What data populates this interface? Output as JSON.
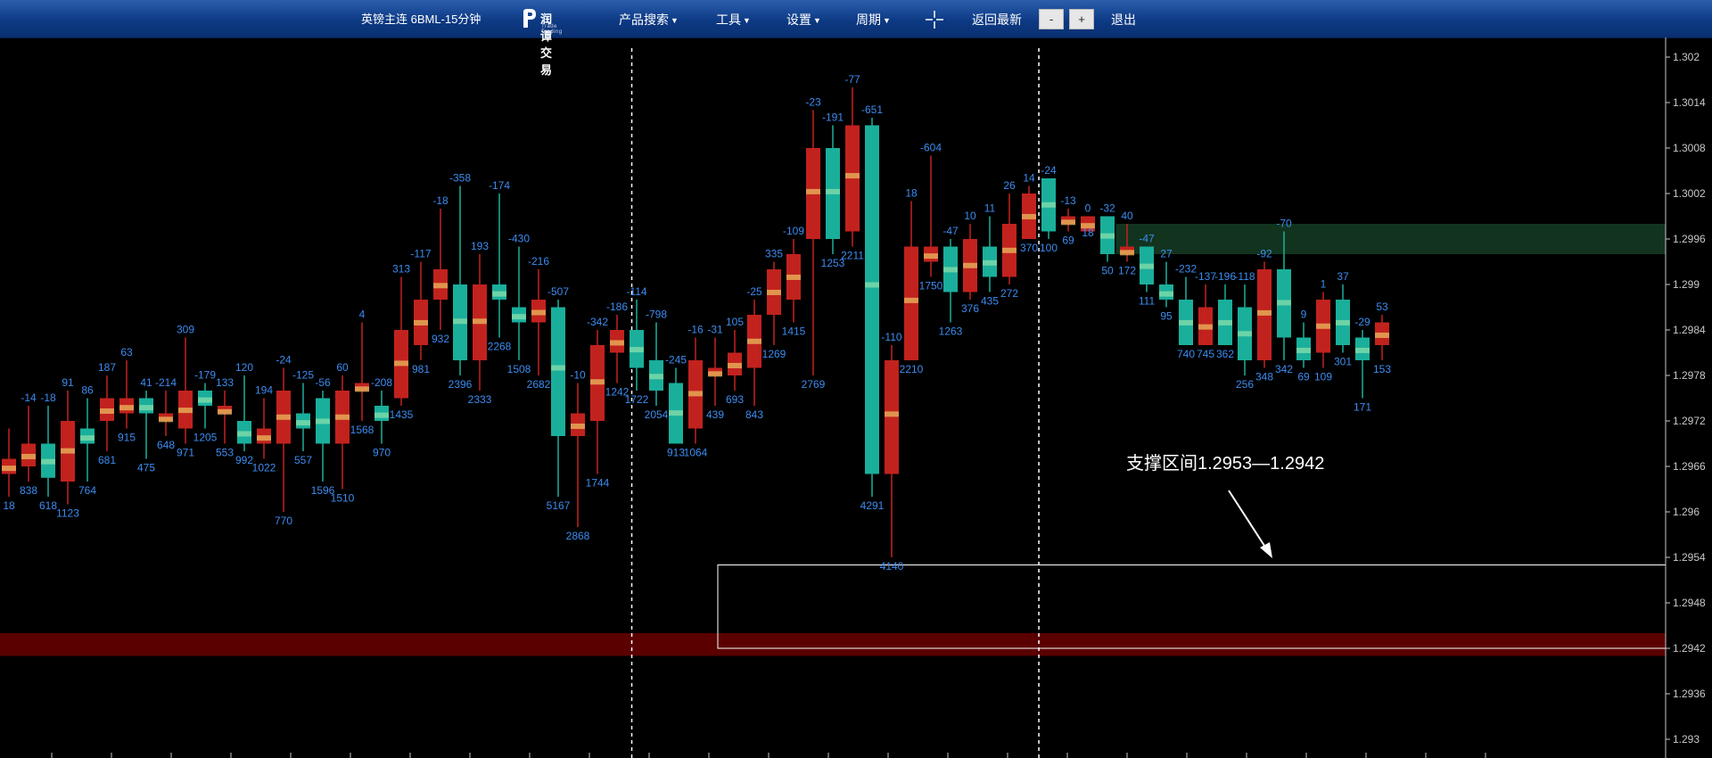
{
  "toolbar": {
    "symbol": "英镑主连 6BML-15分钟",
    "logo_name": "润谭交易",
    "logo_sub": "Trade Trading",
    "menu_product": "产品搜索",
    "menu_tools": "工具",
    "menu_settings": "设置",
    "menu_period": "周期",
    "back_latest": "返回最新",
    "zoom_out": "-",
    "zoom_in": "+",
    "exit": "退出"
  },
  "annotation": {
    "text": "支撑区间1.2953—1.2942"
  },
  "colors": {
    "bull": "#1aaf9b",
    "bear": "#c2221e",
    "bull_light": "#7fdcaa",
    "bear_light": "#e8b15a",
    "label": "#3c8cf0",
    "axis": "#c8c8c8",
    "support_zone": "#5a0000",
    "resistance_zone": "#143a22",
    "annotation_box": "#ffffff"
  },
  "chart_data": {
    "type": "candlestick",
    "price_axis": {
      "ticks": [
        "1.302",
        "1.3014",
        "1.3008",
        "1.3002",
        "1.2996",
        "1.299",
        "1.2984",
        "1.2978",
        "1.2972",
        "1.2966",
        "1.296",
        "1.2954",
        "1.2948",
        "1.2942",
        "1.2936",
        "1.293"
      ]
    },
    "session_separators": [
      0.3793,
      0.6237
    ],
    "zones": [
      {
        "kind": "support",
        "from": 1.2944,
        "to": 1.2941,
        "x0": 0.0,
        "x1": 1.0,
        "color": "#5a0000"
      },
      {
        "kind": "resistance",
        "from": 1.2998,
        "to": 1.2994,
        "x0": 0.67,
        "x1": 1.0,
        "color": "#143a22"
      },
      {
        "kind": "support-box",
        "from": 1.2953,
        "to": 1.2942,
        "x0": 0.42,
        "x1": 1.0
      }
    ],
    "candles": [
      {
        "o": 1.2967,
        "h": 1.2971,
        "l": 1.2962,
        "c": 1.2965,
        "top": "",
        "bot": "18"
      },
      {
        "o": 1.2969,
        "h": 1.2974,
        "l": 1.2964,
        "c": 1.2966,
        "top": "-14",
        "bot": "838"
      },
      {
        "o": 1.29645,
        "h": 1.2974,
        "l": 1.2962,
        "c": 1.2969,
        "top": "-18",
        "bot": "618"
      },
      {
        "o": 1.2972,
        "h": 1.2976,
        "l": 1.2961,
        "c": 1.2964,
        "top": "91",
        "bot": "1123"
      },
      {
        "o": 1.2969,
        "h": 1.2975,
        "l": 1.2964,
        "c": 1.2971,
        "top": "86",
        "bot": "764"
      },
      {
        "o": 1.2975,
        "h": 1.2978,
        "l": 1.2968,
        "c": 1.2972,
        "top": "187",
        "bot": "681"
      },
      {
        "o": 1.2975,
        "h": 1.298,
        "l": 1.2971,
        "c": 1.2973,
        "top": "63",
        "bot": "915"
      },
      {
        "o": 1.2973,
        "h": 1.2976,
        "l": 1.2967,
        "c": 1.2975,
        "top": "41",
        "bot": "475"
      },
      {
        "o": 1.2973,
        "h": 1.2976,
        "l": 1.297,
        "c": 1.2972,
        "top": "-214",
        "bot": "648"
      },
      {
        "o": 1.2976,
        "h": 1.2983,
        "l": 1.2969,
        "c": 1.2971,
        "top": "309",
        "bot": "971"
      },
      {
        "o": 1.2974,
        "h": 1.2977,
        "l": 1.2971,
        "c": 1.2976,
        "top": "-179",
        "bot": "1205"
      },
      {
        "o": 1.2974,
        "h": 1.2976,
        "l": 1.2969,
        "c": 1.2973,
        "top": "133",
        "bot": "553"
      },
      {
        "o": 1.2969,
        "h": 1.2978,
        "l": 1.2968,
        "c": 1.2972,
        "top": "120",
        "bot": "992"
      },
      {
        "o": 1.2971,
        "h": 1.2975,
        "l": 1.2967,
        "c": 1.2969,
        "top": "194",
        "bot": "1022"
      },
      {
        "o": 1.2976,
        "h": 1.2979,
        "l": 1.296,
        "c": 1.2969,
        "top": "-24",
        "bot": "770"
      },
      {
        "o": 1.2971,
        "h": 1.2977,
        "l": 1.2968,
        "c": 1.2973,
        "top": "-125",
        "bot": "557"
      },
      {
        "o": 1.2969,
        "h": 1.2976,
        "l": 1.2964,
        "c": 1.2975,
        "top": "-56",
        "bot": "1596"
      },
      {
        "o": 1.2976,
        "h": 1.2978,
        "l": 1.2963,
        "c": 1.2969,
        "top": "60",
        "bot": "1510"
      },
      {
        "o": 1.2977,
        "h": 1.2985,
        "l": 1.2972,
        "c": 1.2976,
        "top": "4",
        "bot": "1568"
      },
      {
        "o": 1.2972,
        "h": 1.2976,
        "l": 1.2969,
        "c": 1.2974,
        "top": "-208",
        "bot": "970"
      },
      {
        "o": 1.2984,
        "h": 1.2991,
        "l": 1.2974,
        "c": 1.2975,
        "top": "313",
        "bot": "1435"
      },
      {
        "o": 1.2988,
        "h": 1.2993,
        "l": 1.298,
        "c": 1.2982,
        "top": "-117",
        "bot": "981"
      },
      {
        "o": 1.2992,
        "h": 1.3,
        "l": 1.2984,
        "c": 1.2988,
        "top": "-18",
        "bot": "932"
      },
      {
        "o": 1.298,
        "h": 1.3003,
        "l": 1.2978,
        "c": 1.299,
        "top": "-358",
        "bot": "2396"
      },
      {
        "o": 1.299,
        "h": 1.2994,
        "l": 1.2976,
        "c": 1.298,
        "top": "193",
        "bot": "2333"
      },
      {
        "o": 1.2988,
        "h": 1.3002,
        "l": 1.2983,
        "c": 1.299,
        "top": "-174",
        "bot": "2268"
      },
      {
        "o": 1.2985,
        "h": 1.2995,
        "l": 1.298,
        "c": 1.2987,
        "top": "-430",
        "bot": "1508"
      },
      {
        "o": 1.2988,
        "h": 1.2992,
        "l": 1.2978,
        "c": 1.2985,
        "top": "-216",
        "bot": "2682"
      },
      {
        "o": 1.297,
        "h": 1.2988,
        "l": 1.2962,
        "c": 1.2987,
        "top": "-507",
        "bot": "5167"
      },
      {
        "o": 1.2973,
        "h": 1.2977,
        "l": 1.2958,
        "c": 1.297,
        "top": "-10",
        "bot": "2868"
      },
      {
        "o": 1.2982,
        "h": 1.2984,
        "l": 1.2965,
        "c": 1.2972,
        "top": "-342",
        "bot": "1744"
      },
      {
        "o": 1.2984,
        "h": 1.2986,
        "l": 1.2977,
        "c": 1.2981,
        "top": "-186",
        "bot": "1242"
      },
      {
        "o": 1.2979,
        "h": 1.2988,
        "l": 1.2976,
        "c": 1.2984,
        "top": "-114",
        "bot": "1722"
      },
      {
        "o": 1.2976,
        "h": 1.2985,
        "l": 1.2974,
        "c": 1.298,
        "top": "-798",
        "bot": "2054"
      },
      {
        "o": 1.2969,
        "h": 1.2979,
        "l": 1.2969,
        "c": 1.2977,
        "top": "-245",
        "bot": "913"
      },
      {
        "o": 1.298,
        "h": 1.2983,
        "l": 1.2969,
        "c": 1.2971,
        "top": "-16",
        "bot": "1064"
      },
      {
        "o": 1.2979,
        "h": 1.2983,
        "l": 1.2974,
        "c": 1.2978,
        "top": "-31",
        "bot": "439"
      },
      {
        "o": 1.2981,
        "h": 1.2984,
        "l": 1.2976,
        "c": 1.2978,
        "top": "105",
        "bot": "693"
      },
      {
        "o": 1.2986,
        "h": 1.2988,
        "l": 1.2974,
        "c": 1.2979,
        "top": "-25",
        "bot": "843"
      },
      {
        "o": 1.2992,
        "h": 1.2993,
        "l": 1.2982,
        "c": 1.2986,
        "top": "335",
        "bot": "1269"
      },
      {
        "o": 1.2994,
        "h": 1.2996,
        "l": 1.2985,
        "c": 1.2988,
        "top": "-109",
        "bot": "1415"
      },
      {
        "o": 1.3008,
        "h": 1.3013,
        "l": 1.2978,
        "c": 1.2996,
        "top": "-23",
        "bot": "2769"
      },
      {
        "o": 1.2996,
        "h": 1.3011,
        "l": 1.2994,
        "c": 1.3008,
        "top": "-191",
        "bot": "1253"
      },
      {
        "o": 1.3011,
        "h": 1.3016,
        "l": 1.2995,
        "c": 1.2997,
        "top": "-77",
        "bot": "2211"
      },
      {
        "o": 1.2965,
        "h": 1.3012,
        "l": 1.2962,
        "c": 1.3011,
        "top": "-651",
        "bot": "4291"
      },
      {
        "o": 1.298,
        "h": 1.2982,
        "l": 1.2954,
        "c": 1.2965,
        "top": "-110",
        "bot": "4140"
      },
      {
        "o": 1.2995,
        "h": 1.3001,
        "l": 1.298,
        "c": 1.298,
        "top": "18",
        "bot": "2210"
      },
      {
        "o": 1.2995,
        "h": 1.3007,
        "l": 1.2991,
        "c": 1.2993,
        "top": "-604",
        "bot": "1750"
      },
      {
        "o": 1.2989,
        "h": 1.2996,
        "l": 1.2985,
        "c": 1.2995,
        "top": "-47",
        "bot": "1263"
      },
      {
        "o": 1.2996,
        "h": 1.2998,
        "l": 1.2988,
        "c": 1.2989,
        "top": "10",
        "bot": "376"
      },
      {
        "o": 1.2991,
        "h": 1.2999,
        "l": 1.2989,
        "c": 1.2995,
        "top": "11",
        "bot": "435"
      },
      {
        "o": 1.2998,
        "h": 1.3002,
        "l": 1.299,
        "c": 1.2991,
        "top": "26",
        "bot": "272"
      },
      {
        "o": 1.3002,
        "h": 1.3003,
        "l": 1.2996,
        "c": 1.2996,
        "top": "14",
        "bot": "370"
      },
      {
        "o": 1.2997,
        "h": 1.3004,
        "l": 1.2996,
        "c": 1.3004,
        "top": "-24",
        "bot": "100"
      },
      {
        "o": 1.2999,
        "h": 1.3,
        "l": 1.2997,
        "c": 1.2998,
        "top": "-13",
        "bot": "69"
      },
      {
        "o": 1.2999,
        "h": 1.2999,
        "l": 1.2998,
        "c": 1.2997,
        "top": "0",
        "bot": "18"
      },
      {
        "o": 1.2994,
        "h": 1.2999,
        "l": 1.2993,
        "c": 1.2999,
        "top": "-32",
        "bot": "50"
      },
      {
        "o": 1.2995,
        "h": 1.2998,
        "l": 1.2993,
        "c": 1.2994,
        "top": "40",
        "bot": "172"
      },
      {
        "o": 1.299,
        "h": 1.2995,
        "l": 1.2989,
        "c": 1.2995,
        "top": "-47",
        "bot": "111"
      },
      {
        "o": 1.2988,
        "h": 1.2993,
        "l": 1.2987,
        "c": 1.299,
        "top": "27",
        "bot": "95"
      },
      {
        "o": 1.2982,
        "h": 1.2991,
        "l": 1.2982,
        "c": 1.2988,
        "top": "-232",
        "bot": "740"
      },
      {
        "o": 1.2987,
        "h": 1.299,
        "l": 1.2982,
        "c": 1.2982,
        "top": "-137",
        "bot": "745"
      },
      {
        "o": 1.2982,
        "h": 1.299,
        "l": 1.2982,
        "c": 1.2988,
        "top": "-196",
        "bot": "362"
      },
      {
        "o": 1.298,
        "h": 1.299,
        "l": 1.2978,
        "c": 1.2987,
        "top": "-118",
        "bot": "256"
      },
      {
        "o": 1.2992,
        "h": 1.2993,
        "l": 1.2979,
        "c": 1.298,
        "top": "-92",
        "bot": "348"
      },
      {
        "o": 1.2983,
        "h": 1.2997,
        "l": 1.298,
        "c": 1.2992,
        "top": "-70",
        "bot": "342"
      },
      {
        "o": 1.298,
        "h": 1.2985,
        "l": 1.2979,
        "c": 1.2983,
        "top": "9",
        "bot": "69"
      },
      {
        "o": 1.2988,
        "h": 1.2989,
        "l": 1.2979,
        "c": 1.2981,
        "top": "1",
        "bot": "109"
      },
      {
        "o": 1.2982,
        "h": 1.299,
        "l": 1.2981,
        "c": 1.2988,
        "top": "37",
        "bot": "301"
      },
      {
        "o": 1.298,
        "h": 1.2984,
        "l": 1.2975,
        "c": 1.2983,
        "top": "-29",
        "bot": "171"
      },
      {
        "o": 1.2985,
        "h": 1.2986,
        "l": 1.298,
        "c": 1.2982,
        "top": "53",
        "bot": "153"
      }
    ]
  }
}
